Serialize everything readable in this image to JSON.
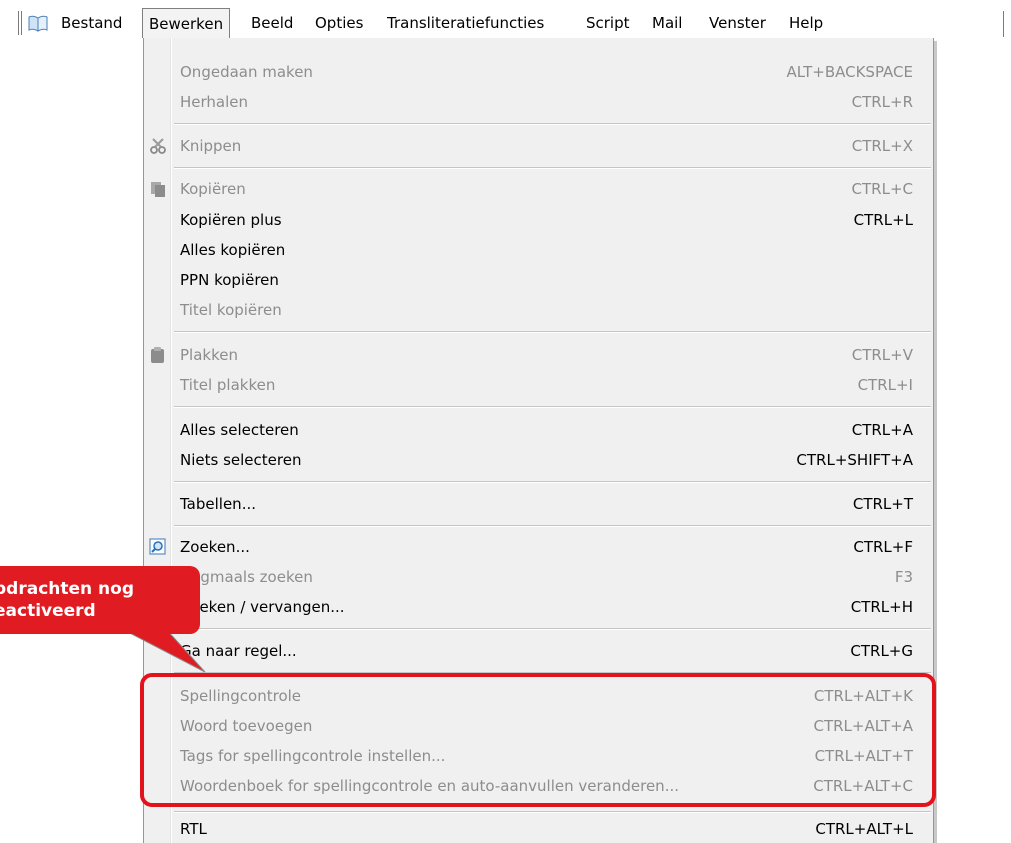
{
  "menubar": {
    "items": [
      "Bestand",
      "Bewerken",
      "Beeld",
      "Opties",
      "Transliteratiefuncties",
      "Script",
      "Mail",
      "Venster",
      "Help"
    ],
    "active": "Bewerken"
  },
  "menu": {
    "items": [
      {
        "label": "Ongedaan maken",
        "shortcut": "ALT+BACKSPACE",
        "enabled": false
      },
      {
        "label": "Herhalen",
        "shortcut": "CTRL+R",
        "enabled": false
      },
      {
        "label": "Knippen",
        "shortcut": "CTRL+X",
        "enabled": false,
        "icon": "scissors-icon"
      },
      {
        "label": "Kopiëren",
        "shortcut": "CTRL+C",
        "enabled": false,
        "icon": "copy-icon"
      },
      {
        "label": "Kopiëren plus",
        "shortcut": "CTRL+L",
        "enabled": true
      },
      {
        "label": "Alles kopiëren",
        "shortcut": "",
        "enabled": true
      },
      {
        "label": "PPN kopiëren",
        "shortcut": "",
        "enabled": true
      },
      {
        "label": "Titel kopiëren",
        "shortcut": "",
        "enabled": false
      },
      {
        "label": "Plakken",
        "shortcut": "CTRL+V",
        "enabled": false,
        "icon": "paste-icon"
      },
      {
        "label": "Titel plakken",
        "shortcut": "CTRL+I",
        "enabled": false
      },
      {
        "label": "Alles selecteren",
        "shortcut": "CTRL+A",
        "enabled": true
      },
      {
        "label": "Niets selecteren",
        "shortcut": "CTRL+SHIFT+A",
        "enabled": true
      },
      {
        "label": "Tabellen...",
        "shortcut": "CTRL+T",
        "enabled": true
      },
      {
        "label": "Zoeken...",
        "shortcut": "CTRL+F",
        "enabled": true,
        "icon": "search-icon"
      },
      {
        "label": "Nogmaals zoeken",
        "shortcut": "F3",
        "enabled": false
      },
      {
        "label": "Zoeken / vervangen...",
        "shortcut": "CTRL+H",
        "enabled": true
      },
      {
        "label": "Ga naar regel...",
        "shortcut": "CTRL+G",
        "enabled": true
      },
      {
        "label": "Spellingcontrole",
        "shortcut": "CTRL+ALT+K",
        "enabled": false
      },
      {
        "label": "Woord toevoegen",
        "shortcut": "CTRL+ALT+A",
        "enabled": false
      },
      {
        "label": "Tags for spellingcontrole instellen...",
        "shortcut": "CTRL+ALT+T",
        "enabled": false
      },
      {
        "label": "Woordenboek for spellingcontrole en auto-aanvullen veranderen...",
        "shortcut": "CTRL+ALT+C",
        "enabled": false
      },
      {
        "label": "RTL",
        "shortcut": "CTRL+ALT+L",
        "enabled": true
      }
    ]
  },
  "callout": {
    "line1": "pdrachten nog",
    "line2": "eactiveerd"
  },
  "colors": {
    "highlight": "#e3131c",
    "disabled_text": "#8d8d8d",
    "menu_bg": "#f0f0f0"
  }
}
